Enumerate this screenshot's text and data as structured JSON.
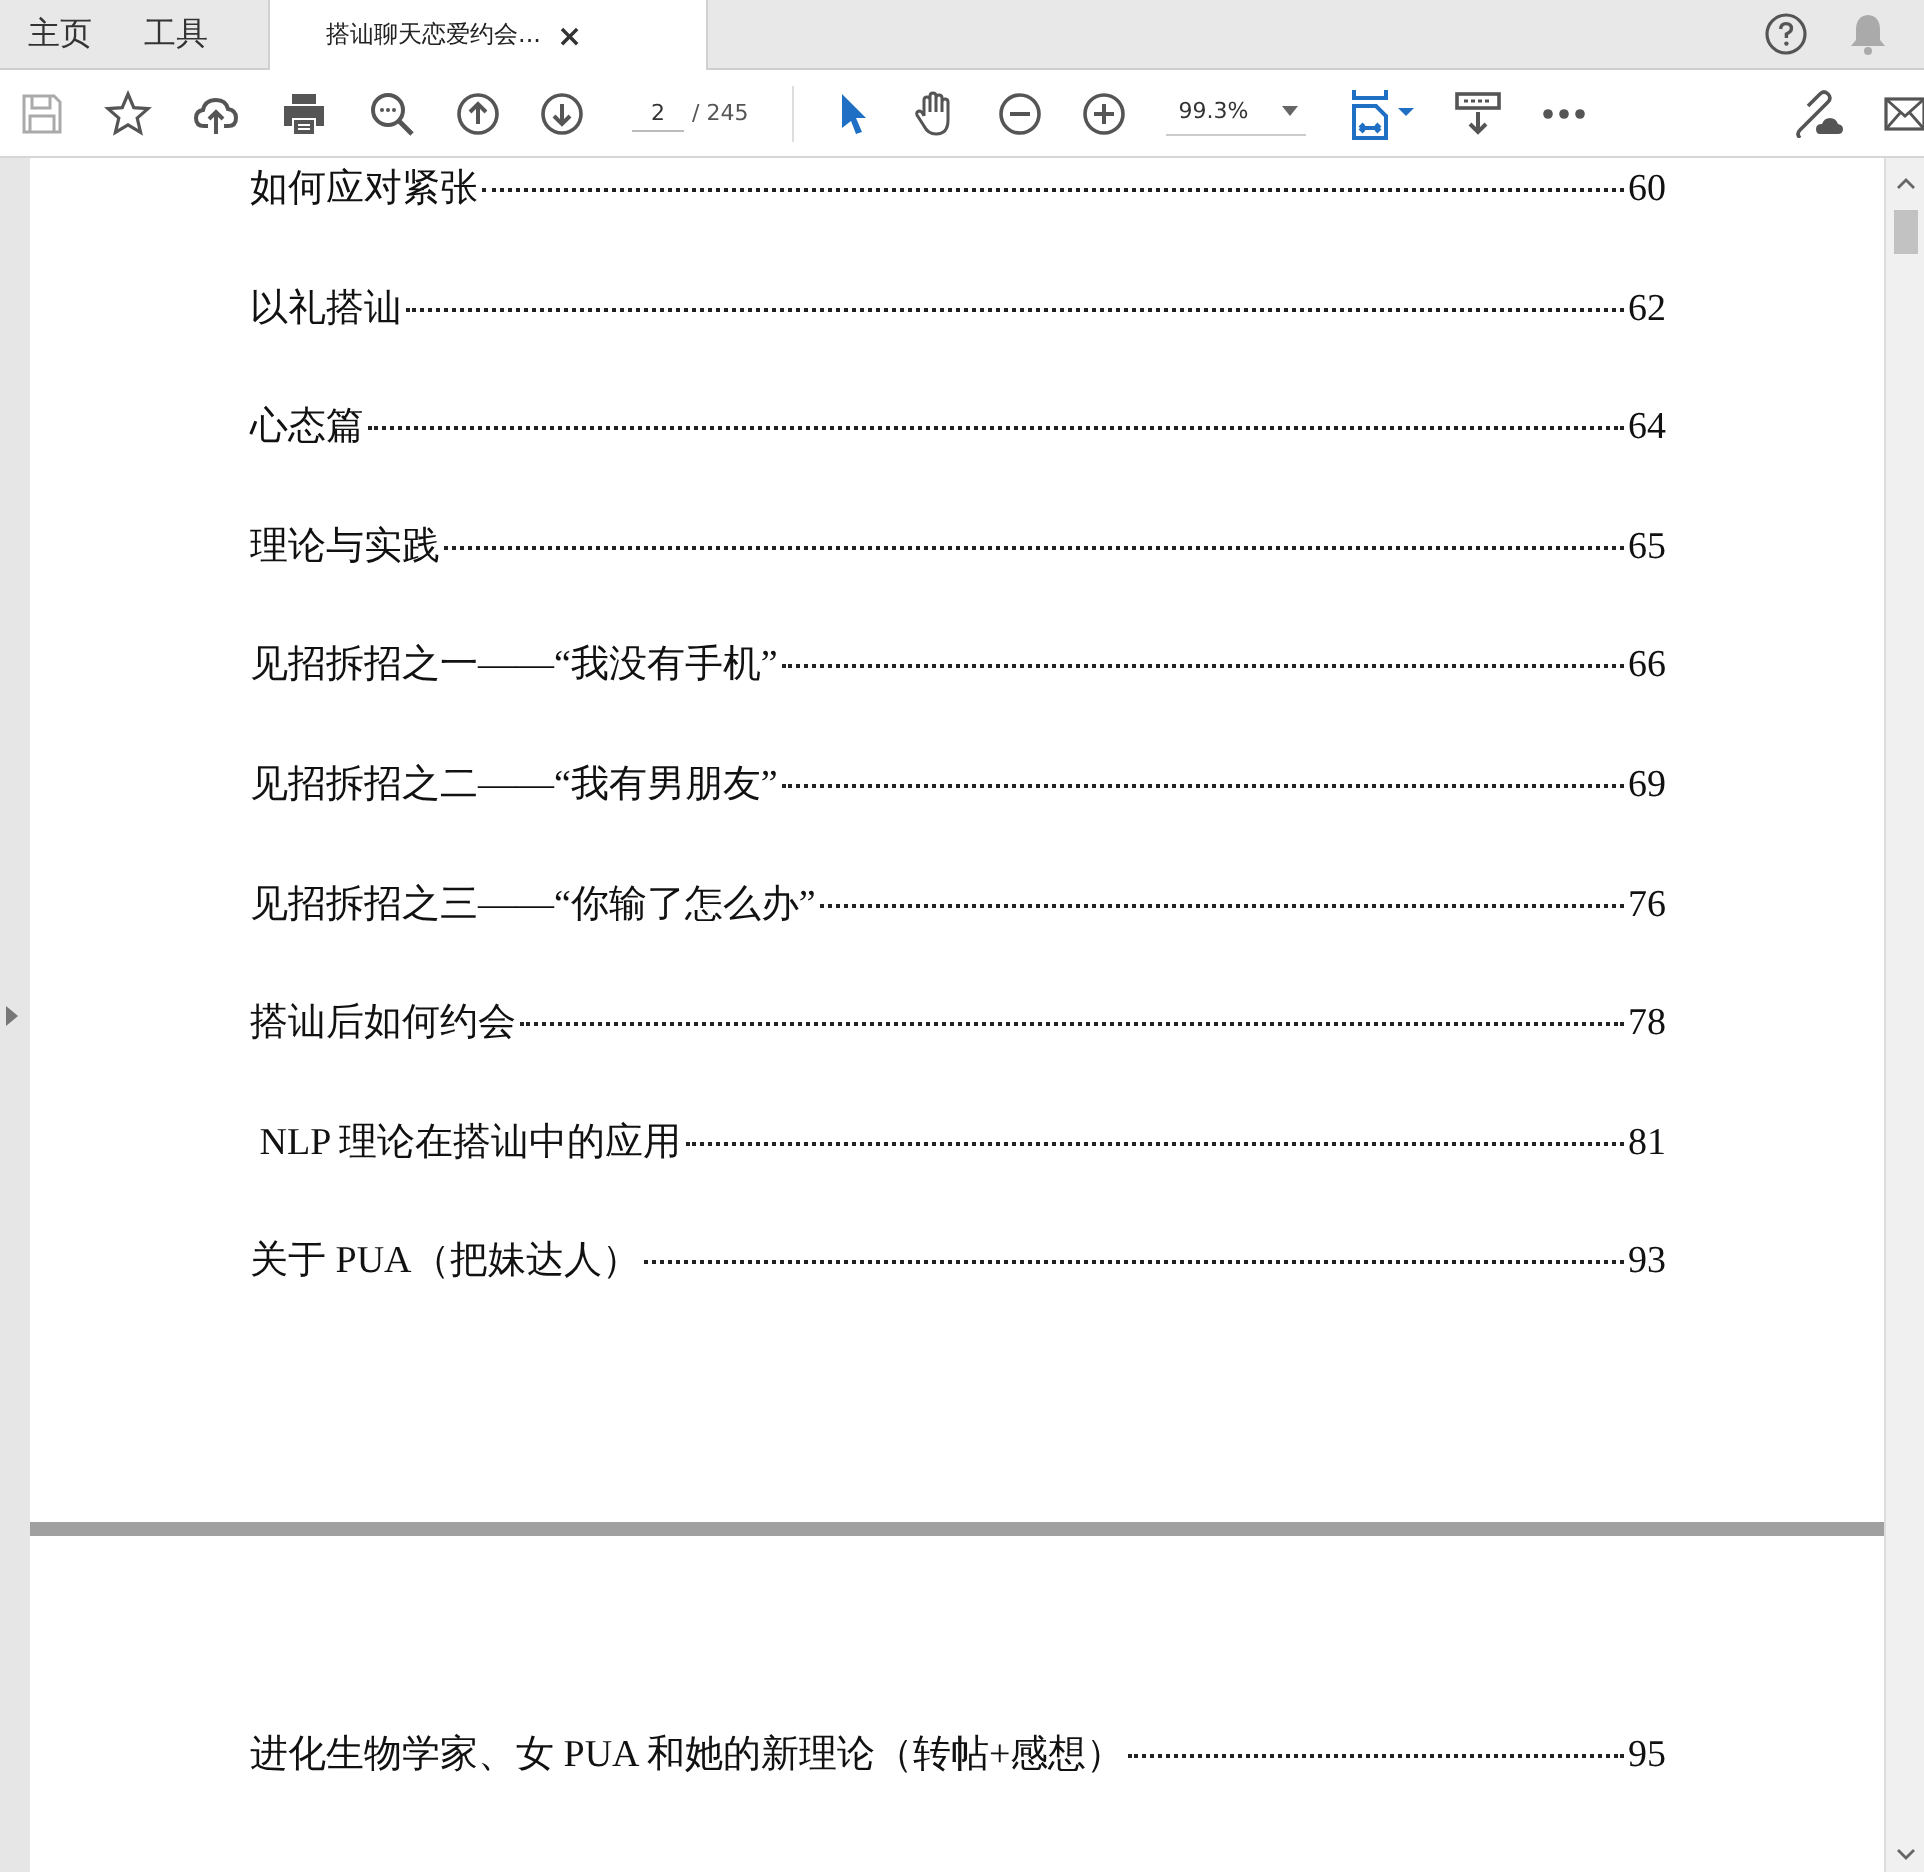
{
  "tabs": [
    {
      "label": "主页",
      "kind": "nav",
      "selected": false
    },
    {
      "label": "工具",
      "kind": "nav",
      "selected": false
    },
    {
      "label": "搭讪聊天恋爱约会...",
      "kind": "document",
      "selected": true,
      "close": "×"
    }
  ],
  "toolbar": {
    "page_number": "2",
    "page_total": "/ 245",
    "zoom": "99.3%"
  },
  "pages": [
    {
      "entries": [
        {
          "title": "如何应对紧张",
          "page": "60"
        },
        {
          "title": "以礼搭讪",
          "page": "62"
        },
        {
          "title": "心态篇",
          "page": "64"
        },
        {
          "title": "理论与实践",
          "page": "65"
        },
        {
          "title": "见招拆招之一——“我没有手机”",
          "page": "66"
        },
        {
          "title": "见招拆招之二——“我有男朋友”",
          "page": "69"
        },
        {
          "title": "见招拆招之三——“你输了怎么办”",
          "page": "76"
        },
        {
          "title": "搭讪后如何约会",
          "page": "78"
        },
        {
          "title": " NLP 理论在搭讪中的应用",
          "page": "81"
        },
        {
          "title": "关于 PUA（把妹达人）",
          "page": "93"
        }
      ]
    },
    {
      "entries": [
        {
          "title": "进化生物学家、女 PUA 和她的新理论（转帖+感想）",
          "page": "95"
        }
      ]
    }
  ]
}
